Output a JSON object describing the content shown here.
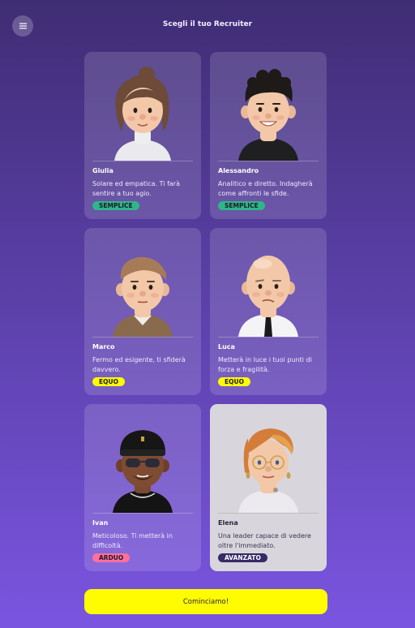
{
  "header": {
    "title": "Scegli il tuo Recruiter",
    "menu_icon": "hamburger-menu-icon"
  },
  "recruiters": [
    {
      "name": "Giulia",
      "description": "Solare ed empatica. Ti farà sentire a tuo agio.",
      "level": "SEMPLICE",
      "level_color": "#2fb58a",
      "selected": false
    },
    {
      "name": "Alessandro",
      "description": "Analitico e diretto. Indagherà come affronti le sfide.",
      "level": "SEMPLICE",
      "level_color": "#2fb58a",
      "selected": false
    },
    {
      "name": "Marco",
      "description": "Fermo ed esigente, ti sfiderà davvero.",
      "level": "EQUO",
      "level_color": "#fffb00",
      "selected": false
    },
    {
      "name": "Luca",
      "description": "Metterà in luce i tuoi punti di forza e fragilità.",
      "level": "EQUO",
      "level_color": "#fffb00",
      "selected": false
    },
    {
      "name": "Ivan",
      "description": "Meticoloso. Ti metterà in difficoltà.",
      "level": "ARDUO",
      "level_color": "#ff6f9c",
      "selected": false
    },
    {
      "name": "Elena",
      "description": "Una leader capace di vedere oltre l'immediato.",
      "level": "AVANZATO",
      "level_color": "#372a67",
      "selected": true
    }
  ],
  "start_button": {
    "label": "Cominciamo!"
  }
}
